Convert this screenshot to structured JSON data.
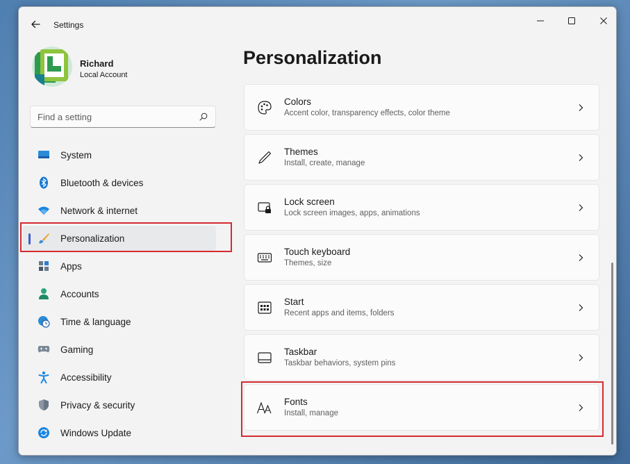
{
  "window": {
    "title": "Settings"
  },
  "user": {
    "name": "Richard",
    "account_type": "Local Account"
  },
  "search": {
    "placeholder": "Find a setting",
    "icon": "search-icon"
  },
  "sidebar": {
    "items": [
      {
        "label": "System",
        "icon": "system-icon"
      },
      {
        "label": "Bluetooth & devices",
        "icon": "bluetooth-icon"
      },
      {
        "label": "Network & internet",
        "icon": "wifi-icon"
      },
      {
        "label": "Personalization",
        "icon": "brush-icon",
        "active": true
      },
      {
        "label": "Apps",
        "icon": "apps-icon"
      },
      {
        "label": "Accounts",
        "icon": "person-icon"
      },
      {
        "label": "Time & language",
        "icon": "globe-clock-icon"
      },
      {
        "label": "Gaming",
        "icon": "gamepad-icon"
      },
      {
        "label": "Accessibility",
        "icon": "accessibility-icon"
      },
      {
        "label": "Privacy & security",
        "icon": "shield-icon"
      },
      {
        "label": "Windows Update",
        "icon": "update-icon"
      }
    ]
  },
  "main": {
    "title": "Personalization",
    "cards": [
      {
        "title": "Colors",
        "subtitle": "Accent color, transparency effects, color theme",
        "icon": "palette-icon"
      },
      {
        "title": "Themes",
        "subtitle": "Install, create, manage",
        "icon": "pen-icon"
      },
      {
        "title": "Lock screen",
        "subtitle": "Lock screen images, apps, animations",
        "icon": "lock-screen-icon"
      },
      {
        "title": "Touch keyboard",
        "subtitle": "Themes, size",
        "icon": "keyboard-icon"
      },
      {
        "title": "Start",
        "subtitle": "Recent apps and items, folders",
        "icon": "start-icon"
      },
      {
        "title": "Taskbar",
        "subtitle": "Taskbar behaviors, system pins",
        "icon": "taskbar-icon"
      },
      {
        "title": "Fonts",
        "subtitle": "Install, manage",
        "icon": "fonts-icon"
      }
    ]
  },
  "colors": {
    "accent": "#3a5fc8",
    "highlight": "#d42a2f"
  }
}
